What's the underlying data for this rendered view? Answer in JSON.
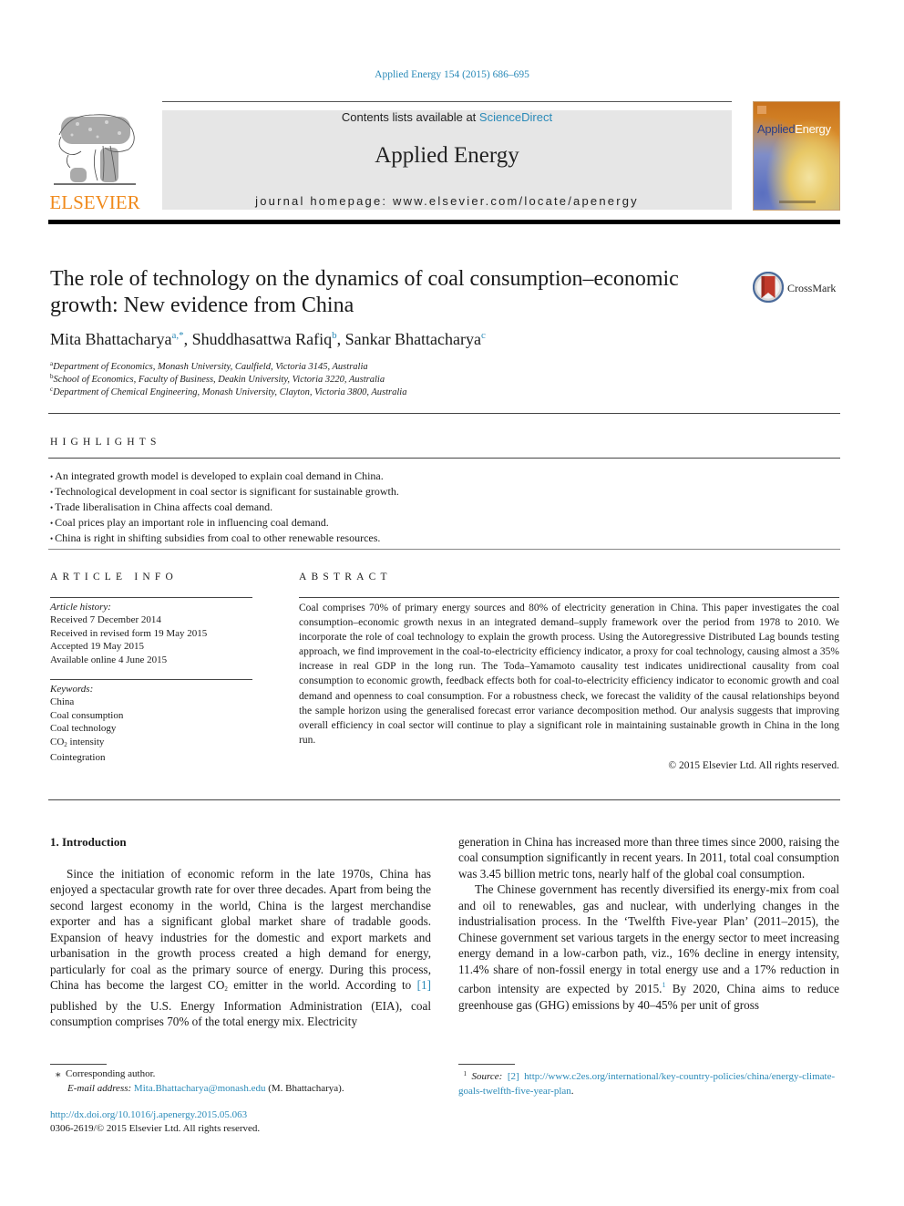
{
  "header": {
    "citation": "Applied Energy 154 (2015) 686–695",
    "contents_prefix": "Contents lists available at ",
    "contents_link": "ScienceDirect",
    "journal_name": "Applied Energy",
    "homepage_prefix": "journal homepage: ",
    "homepage_url": "www.elsevier.com/locate/apenergy",
    "publisher_logo_text": "ELSEVIER",
    "cover_title_part1": "Applied",
    "cover_title_part2": "Energy",
    "crossmark_label": "CrossMark"
  },
  "article": {
    "title": "The role of technology on the dynamics of coal consumption–economic growth: New evidence from China",
    "authors": [
      {
        "name": "Mita Bhattacharya",
        "marks": "a,*"
      },
      {
        "name": "Shuddhasattwa Rafiq",
        "marks": "b"
      },
      {
        "name": "Sankar Bhattacharya",
        "marks": "c"
      }
    ],
    "affiliations": [
      {
        "mark": "a",
        "text": "Department of Economics, Monash University, Caulfield, Victoria 3145, Australia"
      },
      {
        "mark": "b",
        "text": "School of Economics, Faculty of Business, Deakin University, Victoria 3220, Australia"
      },
      {
        "mark": "c",
        "text": "Department of Chemical Engineering, Monash University, Clayton, Victoria 3800, Australia"
      }
    ]
  },
  "highlights": {
    "heading": "HIGHLIGHTS",
    "items": [
      "An integrated growth model is developed to explain coal demand in China.",
      "Technological development in coal sector is significant for sustainable growth.",
      "Trade liberalisation in China affects coal demand.",
      "Coal prices play an important role in influencing coal demand.",
      "China is right in shifting subsidies from coal to other renewable resources."
    ]
  },
  "article_info": {
    "heading": "ARTICLE INFO",
    "history_label": "Article history:",
    "history": [
      "Received 7 December 2014",
      "Received in revised form 19 May 2015",
      "Accepted 19 May 2015",
      "Available online 4 June 2015"
    ],
    "keywords_label": "Keywords:",
    "keywords": [
      "China",
      "Coal consumption",
      "Coal technology",
      "CO",
      "Cointegration"
    ],
    "keyword_co2_subscript": "2",
    "keyword_co2_suffix": " intensity"
  },
  "abstract": {
    "heading": "ABSTRACT",
    "text": "Coal comprises 70% of primary energy sources and 80% of electricity generation in China. This paper investigates the coal consumption–economic growth nexus in an integrated demand–supply framework over the period from 1978 to 2010. We incorporate the role of coal technology to explain the growth process. Using the Autoregressive Distributed Lag bounds testing approach, we find improvement in the coal-to-electricity efficiency indicator, a proxy for coal technology, causing almost a 35% increase in real GDP in the long run. The Toda–Yamamoto causality test indicates unidirectional causality from coal consumption to economic growth, feedback effects both for coal-to-electricity efficiency indicator to economic growth and coal demand and openness to coal consumption. For a robustness check, we forecast the validity of the causal relationships beyond the sample horizon using the generalised forecast error variance decomposition method. Our analysis suggests that improving overall efficiency in coal sector will continue to play a significant role in maintaining sustainable growth in China in the long run.",
    "copyright": "© 2015 Elsevier Ltd. All rights reserved."
  },
  "introduction": {
    "heading": "1. Introduction",
    "p1_a": "Since the initiation of economic reform in the late 1970s, China has enjoyed a spectacular growth rate for over three decades. Apart from being the second largest economy in the world, China is the largest merchandise exporter and has a significant global market share of tradable goods. Expansion of heavy industries for the domestic and export markets and urbanisation in the growth process created a high demand for energy, particularly for coal as the primary source of energy. During this process, China has become the largest CO",
    "p1_sub": "2",
    "p1_b": " emitter in the world. According to ",
    "p1_ref": "[1]",
    "p1_c": " published by the U.S. Energy Information Administration (EIA), coal consumption comprises 70% of the total energy mix. Electricity",
    "p1_cont": "generation in China has increased more than three times since 2000, raising the coal consumption significantly in recent years. In 2011, total coal consumption was 3.45 billion metric tons, nearly half of the global coal consumption.",
    "p2_a": "The Chinese government has recently diversified its energy-mix from coal and oil to renewables, gas and nuclear, with underlying changes in the industrialisation process. In the ‘Twelfth Five-year Plan’ (2011–2015), the Chinese government set various targets in the energy sector to meet increasing energy demand in a low-carbon path, viz., 16% decline in energy intensity, 11.4% share of non-fossil energy in total energy use and a 17% reduction in carbon intensity are expected by 2015.",
    "p2_fn": "1",
    "p2_b": " By 2020, China aims to reduce greenhouse gas (GHG) emissions by 40–45% per unit of gross"
  },
  "footnotes": {
    "corresponding_mark": "⁎",
    "corresponding": "Corresponding author.",
    "email_label": "E-mail address:",
    "email": "Mita.Bhattacharya@monash.edu",
    "email_suffix": " (M. Bhattacharya).",
    "doi": "http://dx.doi.org/10.1016/j.apenergy.2015.05.063",
    "issn_line": "0306-2619/© 2015 Elsevier Ltd. All rights reserved.",
    "fn1_mark": "1",
    "fn1_label": "Source:",
    "fn1_ref": "[2]",
    "fn1_url": "http://www.c2es.org/international/key-country-policies/china/energy-climate-goals-twelfth-five-year-plan",
    "fn1_end": "."
  }
}
